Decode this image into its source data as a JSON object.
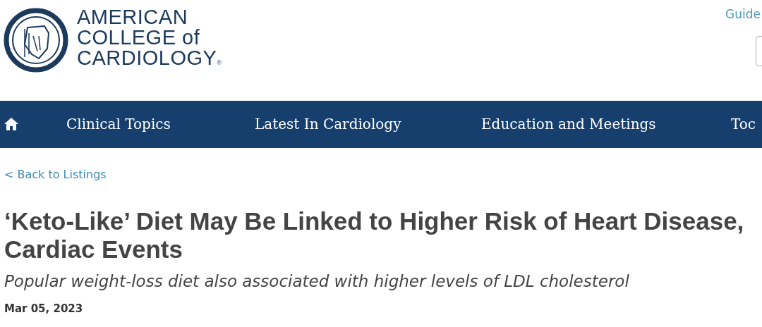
{
  "header": {
    "logo_text": [
      "AMERICAN",
      "COLLEGE of",
      "CARDIOLOGY"
    ],
    "logo_mark": "®",
    "top_link": "Guide"
  },
  "nav": {
    "items": [
      {
        "kind": "home"
      },
      {
        "kind": "text",
        "label": "Clinical Topics"
      },
      {
        "kind": "text",
        "label": "Latest In Cardiology"
      },
      {
        "kind": "text",
        "label": "Education and Meetings"
      },
      {
        "kind": "text",
        "label": "Toc"
      }
    ]
  },
  "article": {
    "back_link": "< Back to Listings",
    "title": "‘Keto-Like’ Diet May Be Linked to Higher Risk of Heart Disease, Cardiac Events",
    "subtitle": "Popular weight-loss diet also associated with higher levels of LDL cholesterol",
    "date": "Mar 05, 2023"
  }
}
